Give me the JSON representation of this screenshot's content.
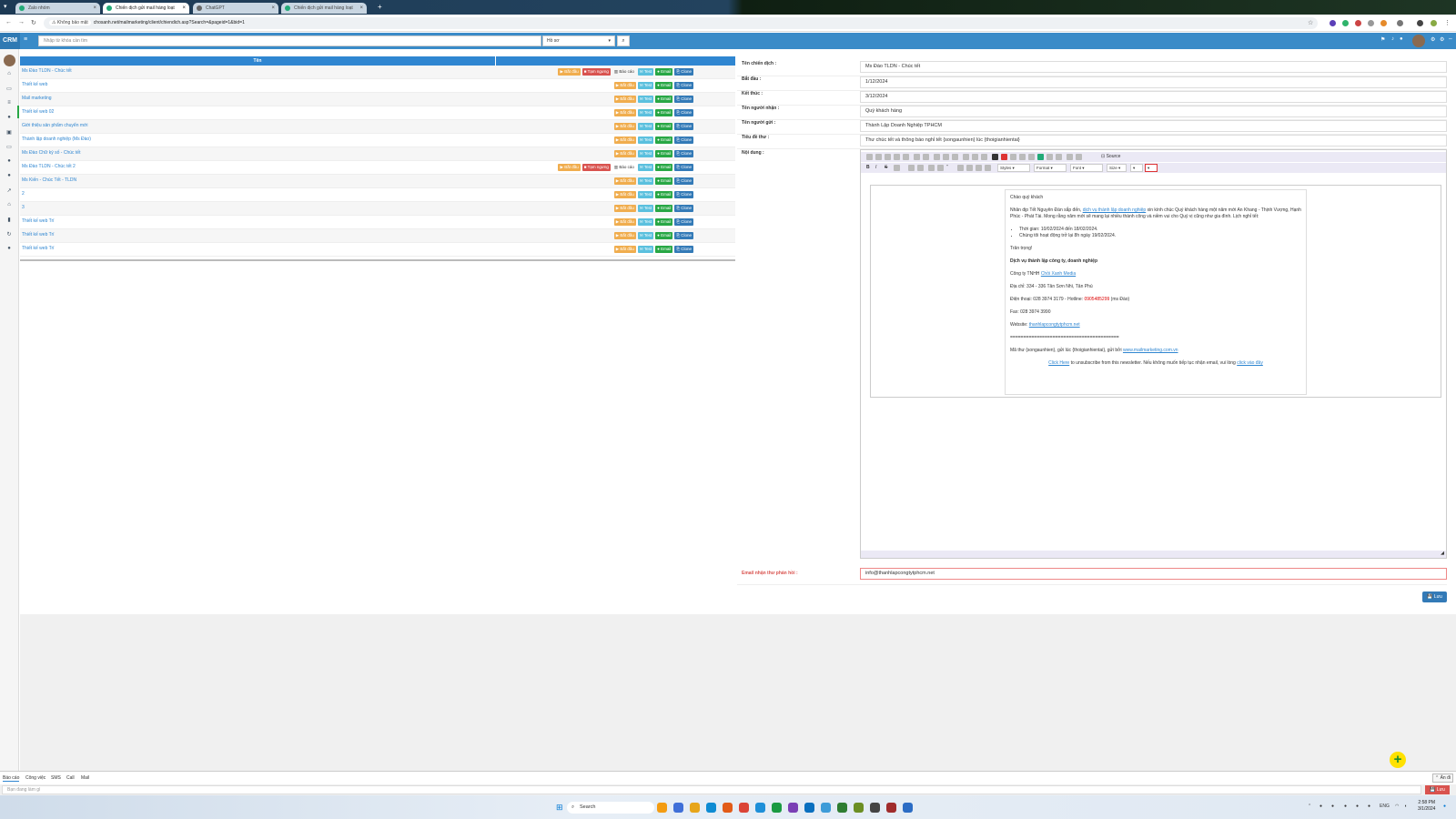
{
  "browser": {
    "tabs": [
      {
        "title": "Zalo nhóm"
      },
      {
        "title": "Chiến dịch gửi mail hàng loạt"
      },
      {
        "title": "ChatGPT"
      },
      {
        "title": "Chiến dịch gửi mail hàng loạt"
      }
    ],
    "security_label": "Không bảo mật",
    "url": "chosanh.net/mailmarketing/client/chiendich.asp?Search=&pageid=1&bid=1"
  },
  "crm": {
    "logo": "CRM",
    "search_placeholder": "Nhập từ khóa cần tìm",
    "search_category": "Hồ sơ"
  },
  "campaign_list": {
    "header_name": "Tên",
    "labels": {
      "start": "Bắt đầu",
      "stop": "Tạm ngưng",
      "report": "Báo cáo",
      "test": "Test",
      "email": "Email",
      "clone": "Clone"
    },
    "rows": [
      {
        "name": "Ms Đào TLDN - Chúc tết",
        "running": true
      },
      {
        "name": "Thiết kế web",
        "running": false
      },
      {
        "name": "Mail marketing",
        "running": false
      },
      {
        "name": "Thiết kế web 02",
        "running": false
      },
      {
        "name": "Giới thiệu sản phẩm chuyển mới",
        "running": false
      },
      {
        "name": "Thành lập doanh nghiệp (Ms Đào)",
        "running": false
      },
      {
        "name": "Ms Đào Chữ ký số - Chúc tết",
        "running": false
      },
      {
        "name": "Ms Đào TLDN - Chúc tết 2",
        "running": true
      },
      {
        "name": "Ms Kiến - Chúc Tết - TLDN",
        "running": false
      },
      {
        "name": "2",
        "running": false
      },
      {
        "name": "3",
        "running": false
      },
      {
        "name": "Thiết kế web Trí",
        "running": false
      },
      {
        "name": "Thiết kế web Trí",
        "running": false
      },
      {
        "name": "Thiết kế web Trí",
        "running": false
      }
    ]
  },
  "form": {
    "campaign_name_label": "Tên chiến dịch :",
    "campaign_name": "Ms Đào TLDN - Chúc tết",
    "start_label": "Bắt đầu :",
    "start": "1/12/2024",
    "end_label": "Kết thúc :",
    "end": "3/12/2024",
    "recipient_label": "Tên người nhận :",
    "recipient": "Quý khách hàng",
    "sender_label": "Tên người gửi :",
    "sender": "Thành Lập Doanh Nghiệp TPHCM",
    "subject_label": "Tiêu đề thư :",
    "subject": "Thư chúc tết và thông báo nghỉ tết {songaunhien} lúc {thoigianhientai}",
    "content_label": "Nội dung :",
    "reply_email_label": "Email nhận thư phản hồi :",
    "reply_email": "info@thanhlapcongtytphcm.net",
    "save_label": "Lưu"
  },
  "editor": {
    "source_label": "Source",
    "styles_label": "Styles",
    "format_label": "Format",
    "font_label": "Font",
    "size_label": "Size"
  },
  "email_body": {
    "greeting": "Chào quý khách",
    "p1_a": "Nhân dịp Tết Nguyên Đán sắp đến, ",
    "p1_link": "dịch vụ thành lập doanh nghiệp",
    "p1_b": " xin kính chúc Quý khách hàng một năm mới An Khang - Thịnh Vượng, Hạnh Phúc - Phát Tài. Mong rằng năm mới sẽ mang lại nhiều thành công và niềm vui cho Quý vị cũng như gia đình. Lịch nghỉ tết:",
    "bullet1": "Thời gian: 10/02/2024 đến 18/02/2024.",
    "bullet2": "Chúng tôi hoạt động trở lại 8h ngày 19/02/2024.",
    "regards": "Trân trọng!",
    "service": "Dịch vụ thành lập công ty, doanh nghiệp",
    "company_a": "Công ty TNHH ",
    "company_link": "Chồi Xanh Media",
    "address": "Địa chỉ: 334 - 336 Tân Sơn Nhì, Tân Phú",
    "phone_a": "Điện thoại: 028 3974 3179 - Hotline: ",
    "hotline": "0905485299",
    "phone_b": " (ms Đào)",
    "fax": "Fax: 028 3974 3990",
    "website_a": "Website: ",
    "website_link": "thanhlapcongtytphcm.net",
    "divider": "=========================================",
    "mailcode_a": "Mã thư {songaunhien}, gửi lúc {thoigianhientai}, gửi bởi ",
    "mailcode_link": "www.mailmarketing.com.vn",
    "unsub_link1": "Click Here",
    "unsub_text": " to unsubscribe from this newsletter. Nếu không muốn tiếp tục nhận email, vui lòng ",
    "unsub_link2": "click vào đây"
  },
  "bottom": {
    "tabs": [
      "Báo cáo",
      "Công việc",
      "SMS",
      "Call",
      "Mail"
    ],
    "hide_label": "Ẩn đi",
    "note_placeholder": "Bạn đang làm gì",
    "note_save": "Lưu"
  },
  "taskbar": {
    "search_label": "Search",
    "lang": "ENG",
    "time": "2:58 PM",
    "date": "3/1/2024"
  }
}
